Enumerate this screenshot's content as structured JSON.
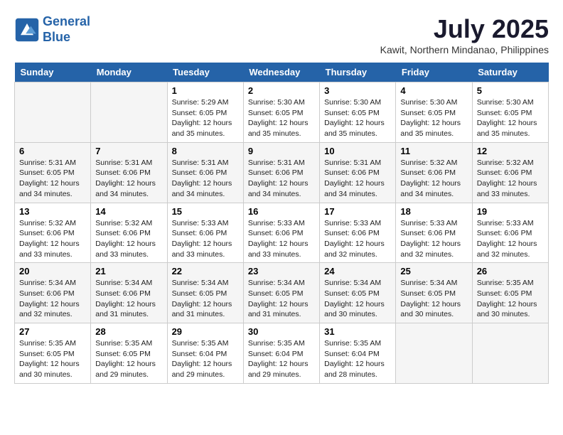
{
  "header": {
    "logo_line1": "General",
    "logo_line2": "Blue",
    "month_title": "July 2025",
    "subtitle": "Kawit, Northern Mindanao, Philippines"
  },
  "days_of_week": [
    "Sunday",
    "Monday",
    "Tuesday",
    "Wednesday",
    "Thursday",
    "Friday",
    "Saturday"
  ],
  "weeks": [
    [
      {
        "day": "",
        "info": ""
      },
      {
        "day": "",
        "info": ""
      },
      {
        "day": "1",
        "sunrise": "5:29 AM",
        "sunset": "6:05 PM",
        "daylight": "12 hours and 35 minutes."
      },
      {
        "day": "2",
        "sunrise": "5:30 AM",
        "sunset": "6:05 PM",
        "daylight": "12 hours and 35 minutes."
      },
      {
        "day": "3",
        "sunrise": "5:30 AM",
        "sunset": "6:05 PM",
        "daylight": "12 hours and 35 minutes."
      },
      {
        "day": "4",
        "sunrise": "5:30 AM",
        "sunset": "6:05 PM",
        "daylight": "12 hours and 35 minutes."
      },
      {
        "day": "5",
        "sunrise": "5:30 AM",
        "sunset": "6:05 PM",
        "daylight": "12 hours and 35 minutes."
      }
    ],
    [
      {
        "day": "6",
        "sunrise": "5:31 AM",
        "sunset": "6:05 PM",
        "daylight": "12 hours and 34 minutes."
      },
      {
        "day": "7",
        "sunrise": "5:31 AM",
        "sunset": "6:06 PM",
        "daylight": "12 hours and 34 minutes."
      },
      {
        "day": "8",
        "sunrise": "5:31 AM",
        "sunset": "6:06 PM",
        "daylight": "12 hours and 34 minutes."
      },
      {
        "day": "9",
        "sunrise": "5:31 AM",
        "sunset": "6:06 PM",
        "daylight": "12 hours and 34 minutes."
      },
      {
        "day": "10",
        "sunrise": "5:31 AM",
        "sunset": "6:06 PM",
        "daylight": "12 hours and 34 minutes."
      },
      {
        "day": "11",
        "sunrise": "5:32 AM",
        "sunset": "6:06 PM",
        "daylight": "12 hours and 34 minutes."
      },
      {
        "day": "12",
        "sunrise": "5:32 AM",
        "sunset": "6:06 PM",
        "daylight": "12 hours and 33 minutes."
      }
    ],
    [
      {
        "day": "13",
        "sunrise": "5:32 AM",
        "sunset": "6:06 PM",
        "daylight": "12 hours and 33 minutes."
      },
      {
        "day": "14",
        "sunrise": "5:32 AM",
        "sunset": "6:06 PM",
        "daylight": "12 hours and 33 minutes."
      },
      {
        "day": "15",
        "sunrise": "5:33 AM",
        "sunset": "6:06 PM",
        "daylight": "12 hours and 33 minutes."
      },
      {
        "day": "16",
        "sunrise": "5:33 AM",
        "sunset": "6:06 PM",
        "daylight": "12 hours and 33 minutes."
      },
      {
        "day": "17",
        "sunrise": "5:33 AM",
        "sunset": "6:06 PM",
        "daylight": "12 hours and 32 minutes."
      },
      {
        "day": "18",
        "sunrise": "5:33 AM",
        "sunset": "6:06 PM",
        "daylight": "12 hours and 32 minutes."
      },
      {
        "day": "19",
        "sunrise": "5:33 AM",
        "sunset": "6:06 PM",
        "daylight": "12 hours and 32 minutes."
      }
    ],
    [
      {
        "day": "20",
        "sunrise": "5:34 AM",
        "sunset": "6:06 PM",
        "daylight": "12 hours and 32 minutes."
      },
      {
        "day": "21",
        "sunrise": "5:34 AM",
        "sunset": "6:06 PM",
        "daylight": "12 hours and 31 minutes."
      },
      {
        "day": "22",
        "sunrise": "5:34 AM",
        "sunset": "6:05 PM",
        "daylight": "12 hours and 31 minutes."
      },
      {
        "day": "23",
        "sunrise": "5:34 AM",
        "sunset": "6:05 PM",
        "daylight": "12 hours and 31 minutes."
      },
      {
        "day": "24",
        "sunrise": "5:34 AM",
        "sunset": "6:05 PM",
        "daylight": "12 hours and 30 minutes."
      },
      {
        "day": "25",
        "sunrise": "5:34 AM",
        "sunset": "6:05 PM",
        "daylight": "12 hours and 30 minutes."
      },
      {
        "day": "26",
        "sunrise": "5:35 AM",
        "sunset": "6:05 PM",
        "daylight": "12 hours and 30 minutes."
      }
    ],
    [
      {
        "day": "27",
        "sunrise": "5:35 AM",
        "sunset": "6:05 PM",
        "daylight": "12 hours and 30 minutes."
      },
      {
        "day": "28",
        "sunrise": "5:35 AM",
        "sunset": "6:05 PM",
        "daylight": "12 hours and 29 minutes."
      },
      {
        "day": "29",
        "sunrise": "5:35 AM",
        "sunset": "6:04 PM",
        "daylight": "12 hours and 29 minutes."
      },
      {
        "day": "30",
        "sunrise": "5:35 AM",
        "sunset": "6:04 PM",
        "daylight": "12 hours and 29 minutes."
      },
      {
        "day": "31",
        "sunrise": "5:35 AM",
        "sunset": "6:04 PM",
        "daylight": "12 hours and 28 minutes."
      },
      {
        "day": "",
        "info": ""
      },
      {
        "day": "",
        "info": ""
      }
    ]
  ],
  "labels": {
    "sunrise_prefix": "Sunrise: ",
    "sunset_prefix": "Sunset: ",
    "daylight_prefix": "Daylight: "
  }
}
